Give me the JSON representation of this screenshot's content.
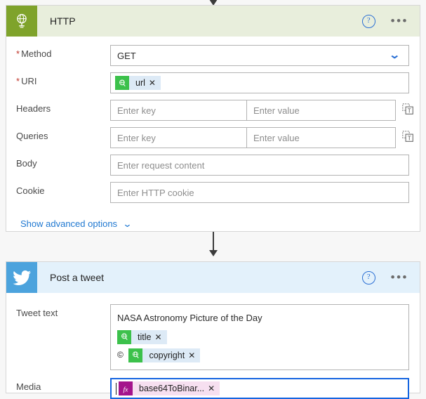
{
  "http_card": {
    "title": "HTTP",
    "icon": "globe-icon",
    "help_label": "?",
    "more_label": "•••",
    "rows": {
      "method": {
        "label": "Method",
        "required": true,
        "value": "GET",
        "chevron": "⌄"
      },
      "uri": {
        "label": "URI",
        "required": true,
        "token": {
          "label": "url",
          "icon": "globe-token-icon",
          "remove": "✕"
        }
      },
      "headers": {
        "label": "Headers",
        "key_placeholder": "Enter key",
        "value_placeholder": "Enter value",
        "text_mode_icon": "text-mode-icon"
      },
      "queries": {
        "label": "Queries",
        "key_placeholder": "Enter key",
        "value_placeholder": "Enter value",
        "text_mode_icon": "text-mode-icon"
      },
      "body": {
        "label": "Body",
        "placeholder": "Enter request content"
      },
      "cookie": {
        "label": "Cookie",
        "placeholder": "Enter HTTP cookie"
      }
    },
    "advanced_link": {
      "label": "Show advanced options",
      "chevron": "⌄"
    }
  },
  "tweet_card": {
    "title": "Post a tweet",
    "icon": "twitter-bird-icon",
    "help_label": "?",
    "more_label": "•••",
    "rows": {
      "tweet_text": {
        "label": "Tweet text",
        "line1": "NASA Astronomy Picture of the Day",
        "token_title": {
          "label": "title",
          "icon": "globe-token-icon",
          "remove": "✕"
        },
        "copyright_symbol": "©",
        "token_copyright": {
          "label": "copyright",
          "icon": "globe-token-icon",
          "remove": "✕"
        }
      },
      "media": {
        "label": "Media",
        "token": {
          "label": "base64ToBinar...",
          "icon": "fx-icon",
          "remove": "✕"
        },
        "focused": true
      }
    }
  },
  "colors": {
    "http_accent": "#7fa32b",
    "http_header_bg": "#e8eedc",
    "twitter_accent": "#4ca3dd",
    "twitter_header_bg": "#e3f1fb",
    "token_green": "#3cc14b",
    "token_bg": "#ddeaf6",
    "fx_purple": "#a4148c",
    "fx_bg": "#f6dff0",
    "focus_blue": "#1565e0",
    "link_blue": "#1f78d1",
    "required_red": "#c0372c",
    "page_bg": "#f7f7f7"
  }
}
